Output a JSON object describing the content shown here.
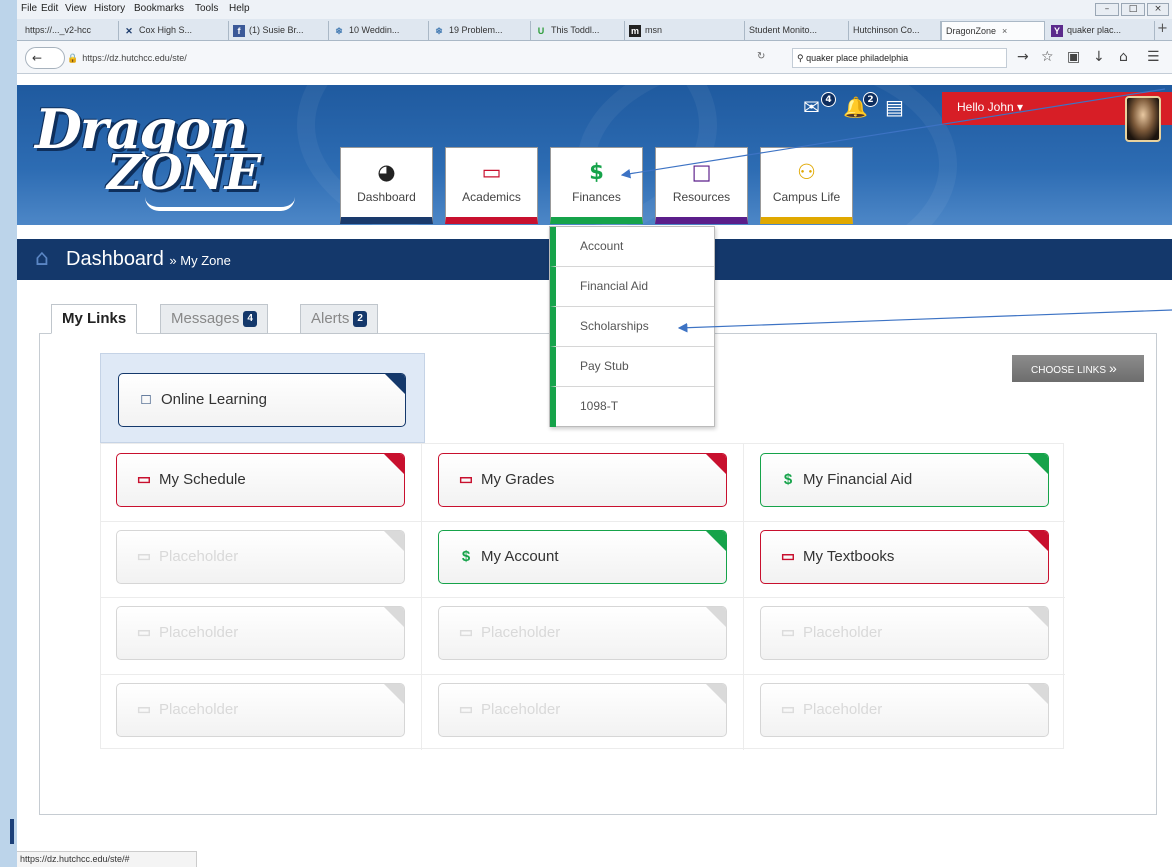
{
  "browser": {
    "menu": [
      "File",
      "Edit",
      "View",
      "History",
      "Bookmarks",
      "Tools",
      "Help"
    ],
    "tabs": [
      {
        "label": "https://..._v2-hcc",
        "icon": "page-icon"
      },
      {
        "label": "Cox High S...",
        "icon": "x-logo-icon"
      },
      {
        "label": "(1) Susie Br...",
        "icon": "facebook-icon"
      },
      {
        "label": "10 Weddin...",
        "icon": "globe-icon"
      },
      {
        "label": "19 Problem...",
        "icon": "globe-icon"
      },
      {
        "label": "This Toddl...",
        "icon": "u-logo-icon"
      },
      {
        "label": "msn",
        "icon": "msn-icon"
      },
      {
        "label": "Student Monito...",
        "icon": "page-icon"
      },
      {
        "label": "Hutchinson Co...",
        "icon": "page-icon"
      },
      {
        "label": "DragonZone",
        "icon": "page-icon",
        "active": true
      },
      {
        "label": "quaker plac...",
        "icon": "yahoo-icon"
      }
    ],
    "url": "https://dz.hutchcc.edu/ste/",
    "search_value": "quaker place philadelphia",
    "status_url": "https://dz.hutchcc.edu/ste/#"
  },
  "header": {
    "logo_line1": "Dragon",
    "logo_line2": "ZONE",
    "mail_count": "4",
    "alert_count": "2",
    "greeting": "Hello John ▾"
  },
  "nav": [
    {
      "label": "Dashboard",
      "icon": "dashboard-gauge-icon",
      "color": "#1a3a6c"
    },
    {
      "label": "Academics",
      "icon": "book-icon",
      "color": "#c8102e"
    },
    {
      "label": "Finances",
      "icon": "dollar-icon",
      "color": "#16a34a"
    },
    {
      "label": "Resources",
      "icon": "laptop-icon",
      "color": "#5b1e8a"
    },
    {
      "label": "Campus Life",
      "icon": "users-icon",
      "color": "#e0a800"
    }
  ],
  "finances_menu": [
    "Account",
    "Financial Aid",
    "Scholarships",
    "Pay Stub",
    "1098-T"
  ],
  "dashboard": {
    "title": "Dashboard",
    "crumb": "» My Zone"
  },
  "content_tabs": [
    {
      "label": "My Links",
      "badge": ""
    },
    {
      "label": "Messages",
      "badge": "4"
    },
    {
      "label": "Alerts",
      "badge": "2"
    }
  ],
  "choose_links": "CHOOSE LINKS",
  "featured_link": {
    "label": "Online Learning",
    "icon": "laptop-icon"
  },
  "links": [
    {
      "label": "My Schedule",
      "icon": "book-icon",
      "color": "#c8102e"
    },
    {
      "label": "My Grades",
      "icon": "book-icon",
      "color": "#c8102e"
    },
    {
      "label": "My Financial Aid",
      "icon": "dollar-icon",
      "color": "#16a34a"
    },
    {
      "label": "Placeholder",
      "icon": "book-icon",
      "placeholder": true
    },
    {
      "label": "My Account",
      "icon": "dollar-icon",
      "color": "#16a34a"
    },
    {
      "label": "My Textbooks",
      "icon": "book-icon",
      "color": "#c8102e"
    },
    {
      "label": "Placeholder",
      "icon": "book-icon",
      "placeholder": true
    },
    {
      "label": "Placeholder",
      "icon": "book-icon",
      "placeholder": true
    },
    {
      "label": "Placeholder",
      "icon": "book-icon",
      "placeholder": true
    },
    {
      "label": "Placeholder",
      "icon": "book-icon",
      "placeholder": true
    },
    {
      "label": "Placeholder",
      "icon": "book-icon",
      "placeholder": true
    },
    {
      "label": "Placeholder",
      "icon": "book-icon",
      "placeholder": true
    }
  ],
  "colors": {
    "brand_navy": "#14386b",
    "header_blue": "#2d6cb3",
    "accent_red": "#d71e26",
    "finance_green": "#16a34a"
  }
}
